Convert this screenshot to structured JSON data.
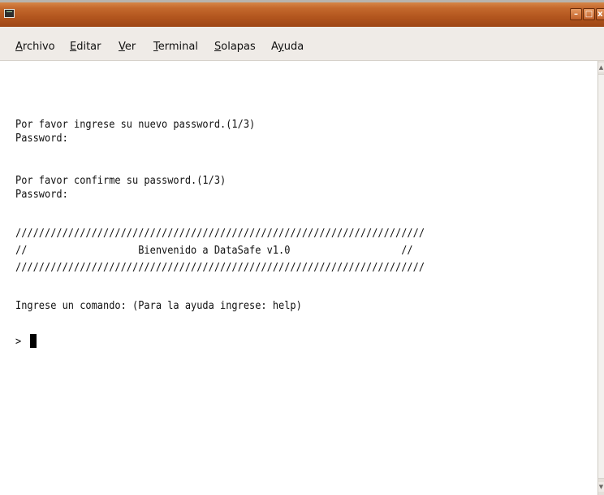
{
  "window": {
    "title": "",
    "minimize_glyph": "–",
    "maximize_glyph": "□",
    "close_glyph": "x"
  },
  "menubar": {
    "items": [
      {
        "mnemonic": "A",
        "rest": "rchivo"
      },
      {
        "mnemonic": "E",
        "rest": "ditar"
      },
      {
        "mnemonic": "V",
        "rest": "er"
      },
      {
        "mnemonic": "T",
        "rest": "erminal"
      },
      {
        "mnemonic": "S",
        "rest": "olapas"
      },
      {
        "pre": "A",
        "mnemonic": "y",
        "rest": "uda"
      }
    ]
  },
  "terminal": {
    "lines": [
      "Por favor ingrese su nuevo password.(1/3)",
      "Password:",
      "Por favor confirme su password.(1/3)",
      "Password:",
      "//////////////////////////////////////////////////////////////////////",
      "//                   Bienvenido a DataSafe v1.0                   //",
      "//////////////////////////////////////////////////////////////////////",
      "Ingrese un comando: (Para la ayuda ingrese: help)",
      ">"
    ]
  },
  "scrollbar": {
    "up_glyph": "▲",
    "down_glyph": "▼"
  }
}
